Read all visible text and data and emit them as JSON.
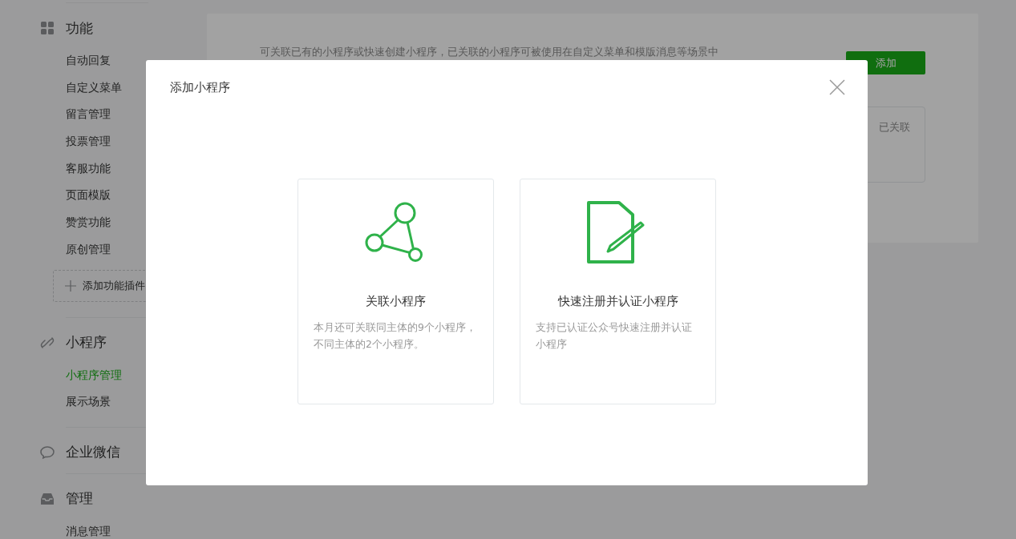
{
  "sidebar": {
    "groups": [
      {
        "title": "功能",
        "items": [
          {
            "label": "自动回复",
            "selected": false
          },
          {
            "label": "自定义菜单",
            "selected": false
          },
          {
            "label": "留言管理",
            "selected": false
          },
          {
            "label": "投票管理",
            "selected": false
          },
          {
            "label": "客服功能",
            "selected": false
          },
          {
            "label": "页面模版",
            "selected": false
          },
          {
            "label": "赞赏功能",
            "selected": false
          },
          {
            "label": "原创管理",
            "selected": false
          }
        ],
        "add_button": "添加功能插件"
      },
      {
        "title": "小程序",
        "items": [
          {
            "label": "小程序管理",
            "selected": true
          },
          {
            "label": "展示场景",
            "selected": false
          }
        ]
      },
      {
        "title": "企业微信"
      },
      {
        "title": "管理",
        "items": [
          {
            "label": "消息管理",
            "selected": false
          }
        ]
      }
    ]
  },
  "main": {
    "description": "可关联已有的小程序或快速创建小程序，已关联的小程序可被使用在自定义菜单和模版消息等场景中",
    "add_button": "添加",
    "linked_label": "已关联"
  },
  "modal": {
    "title": "添加小程序",
    "cards": [
      {
        "title": "关联小程序",
        "description": "本月还可关联同主体的9个小程序，不同主体的2个小程序。"
      },
      {
        "title": "快速注册并认证小程序",
        "description": "支持已认证公众号快速注册并认证小程序"
      }
    ]
  }
}
